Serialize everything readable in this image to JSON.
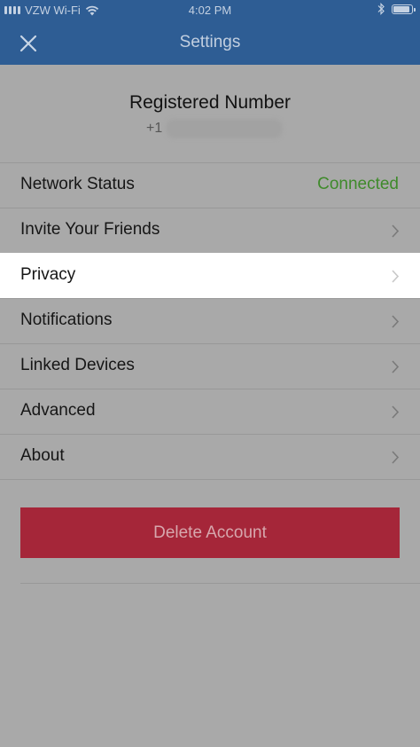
{
  "status_bar": {
    "carrier": "VZW Wi-Fi",
    "time": "4:02 PM",
    "battery_level": 0.9
  },
  "nav": {
    "title": "Settings",
    "close_icon": "close-icon"
  },
  "header": {
    "title": "Registered Number",
    "number_prefix": "+1"
  },
  "rows": [
    {
      "label": "Network Status",
      "status": "Connected",
      "status_color": "#3f8a2b"
    },
    {
      "label": "Invite Your Friends"
    },
    {
      "label": "Privacy"
    },
    {
      "label": "Notifications"
    },
    {
      "label": "Linked Devices"
    },
    {
      "label": "Advanced"
    },
    {
      "label": "About"
    }
  ],
  "delete_button": {
    "label": "Delete Account"
  },
  "colors": {
    "navbar": "#2e5d94",
    "background": "#a9a9a9",
    "danger": "#a52639",
    "highlight_row": "#ffffff"
  }
}
